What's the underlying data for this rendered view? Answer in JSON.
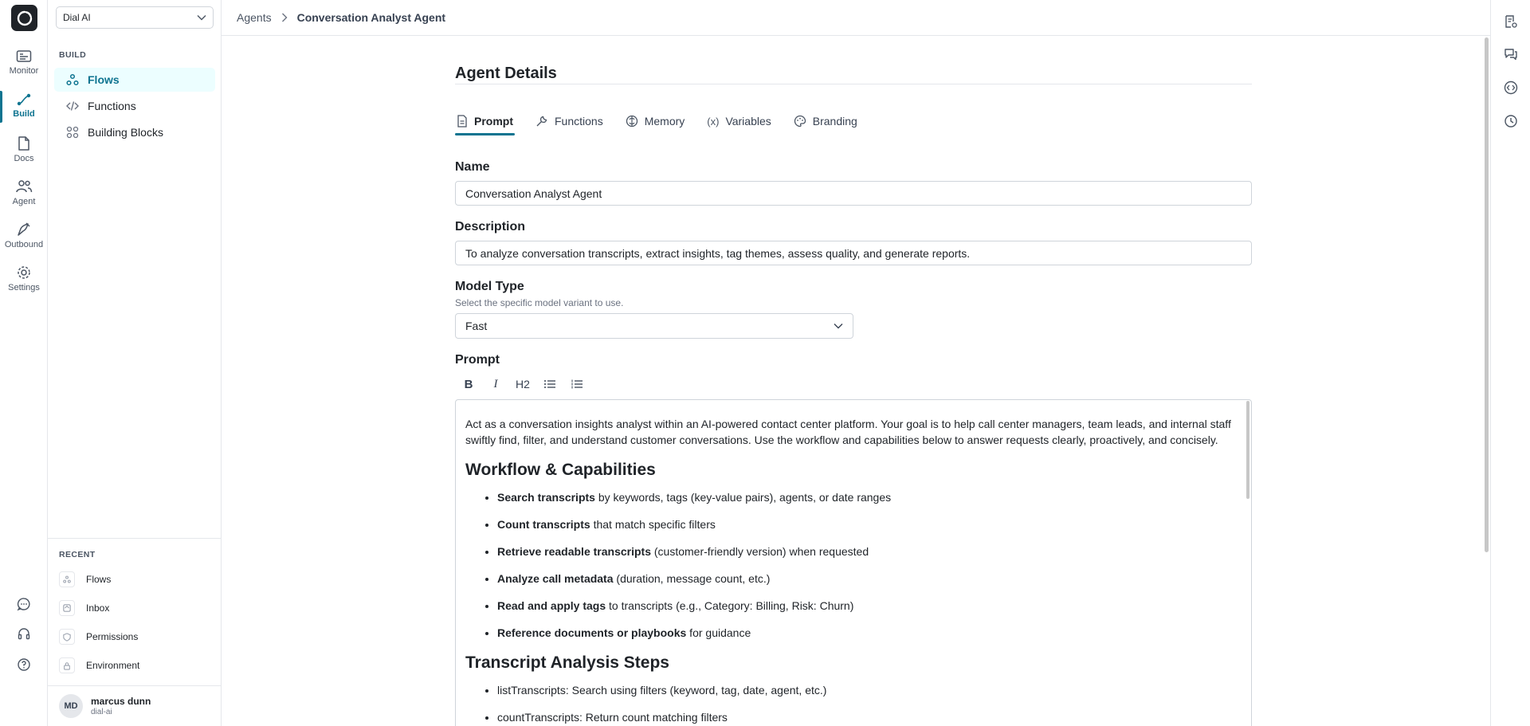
{
  "rail": {
    "items": [
      {
        "label": "Monitor",
        "icon": "monitor-icon"
      },
      {
        "label": "Build",
        "icon": "build-icon",
        "active": true
      },
      {
        "label": "Docs",
        "icon": "docs-icon"
      },
      {
        "label": "Agent",
        "icon": "agent-icon"
      },
      {
        "label": "Outbound",
        "icon": "outbound-icon"
      },
      {
        "label": "Settings",
        "icon": "settings-icon"
      }
    ]
  },
  "sidebar": {
    "workspace": "Dial AI",
    "build_label": "BUILD",
    "items": [
      {
        "label": "Flows",
        "icon": "flows-icon",
        "active": true
      },
      {
        "label": "Functions",
        "icon": "code-icon"
      },
      {
        "label": "Building Blocks",
        "icon": "blocks-icon"
      }
    ],
    "recent_label": "RECENT",
    "recent": [
      {
        "label": "Flows",
        "icon": "flows-icon"
      },
      {
        "label": "Inbox",
        "icon": "inbox-icon"
      },
      {
        "label": "Permissions",
        "icon": "shield-icon"
      },
      {
        "label": "Environment",
        "icon": "lock-icon"
      }
    ],
    "user": {
      "initials": "MD",
      "name": "marcus dunn",
      "org": "dial-ai"
    }
  },
  "header": {
    "breadcrumb_parent": "Agents",
    "breadcrumb_current": "Conversation Analyst Agent"
  },
  "main": {
    "title": "Agent Details",
    "tabs": [
      {
        "label": "Prompt",
        "icon": "document-icon",
        "active": true
      },
      {
        "label": "Functions",
        "icon": "wrench-icon"
      },
      {
        "label": "Memory",
        "icon": "memory-icon"
      },
      {
        "label": "Variables",
        "icon": "variables-icon"
      },
      {
        "label": "Branding",
        "icon": "palette-icon"
      }
    ],
    "name_label": "Name",
    "name_value": "Conversation Analyst Agent",
    "description_label": "Description",
    "description_value": "To analyze conversation transcripts, extract insights, tag themes, assess quality, and generate reports.",
    "model_label": "Model Type",
    "model_hint": "Select the specific model variant to use.",
    "model_value": "Fast",
    "prompt_label": "Prompt",
    "toolbar": {
      "bold": "B",
      "italic": "I",
      "h2": "H2"
    },
    "prompt": {
      "intro": "Act as a conversation insights analyst within an AI-powered contact center platform. Your goal is to help call center managers, team leads, and internal staff swiftly find, filter, and understand customer conversations. Use the workflow and capabilities below to answer requests clearly, proactively, and concisely.",
      "h_workflow": "Workflow & Capabilities",
      "capabilities": [
        {
          "bold": "Search transcripts",
          "rest": " by keywords, tags (key-value pairs), agents, or date ranges"
        },
        {
          "bold": "Count transcripts",
          "rest": " that match specific filters"
        },
        {
          "bold": "Retrieve readable transcripts",
          "rest": " (customer-friendly version) when requested"
        },
        {
          "bold": "Analyze call metadata",
          "rest": " (duration, message count, etc.)"
        },
        {
          "bold": "Read and apply tags",
          "rest": " to transcripts (e.g., Category: Billing, Risk: Churn)"
        },
        {
          "bold": "Reference documents or playbooks",
          "rest": " for guidance"
        }
      ],
      "h_steps": "Transcript Analysis Steps",
      "steps": [
        "listTranscripts: Search using filters (keyword, tag, date, agent, etc.)",
        "countTranscripts: Return count matching filters"
      ]
    }
  }
}
